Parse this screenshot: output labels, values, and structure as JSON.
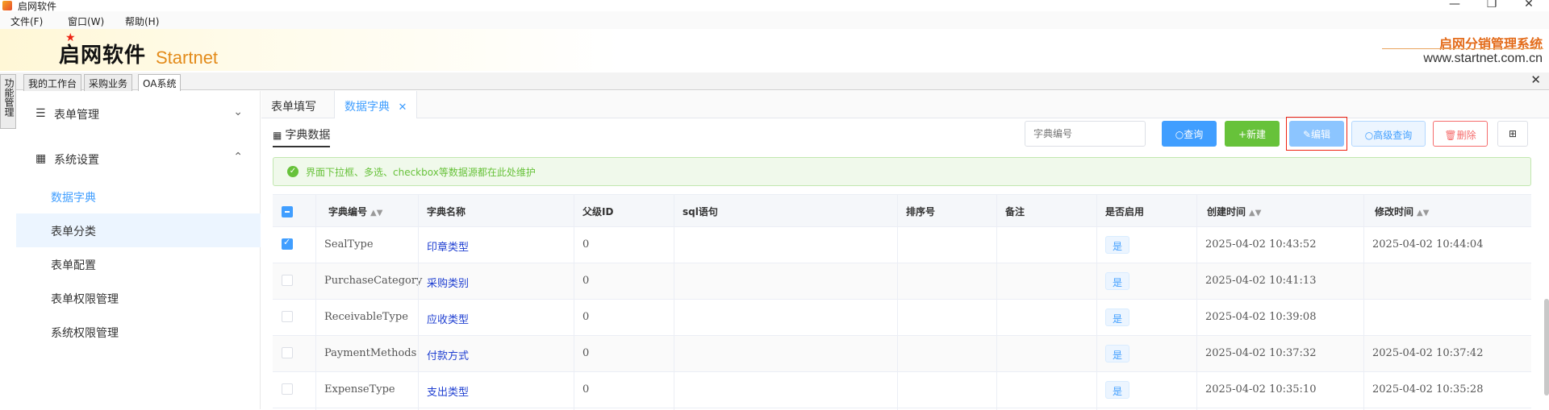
{
  "window": {
    "title": "启网软件",
    "controls": {
      "minimize": "—",
      "maximize": "❐",
      "close": "✕"
    }
  },
  "menu": [
    {
      "label": "文件(F)"
    },
    {
      "label": "窗口(W)"
    },
    {
      "label": "帮助(H)"
    }
  ],
  "banner": {
    "logo_cn": "启网软件",
    "logo_en": "Startnet",
    "system_name": "启网分销管理系统",
    "url": "www.startnet.com.cn"
  },
  "side_strip": {
    "label": "功能管理"
  },
  "top_tabs": [
    {
      "label": "我的工作台"
    },
    {
      "label": "采购业务"
    },
    {
      "label": "OA系统"
    }
  ],
  "sidebar": {
    "groups": [
      {
        "label": "表单管理",
        "icon": "sliders-icon",
        "chevron": "⌄"
      },
      {
        "label": "系统设置",
        "icon": "grid-icon",
        "chevron": "⌃"
      }
    ],
    "items": [
      {
        "label": "数据字典"
      },
      {
        "label": "表单分类"
      },
      {
        "label": "表单配置"
      },
      {
        "label": "表单权限管理"
      },
      {
        "label": "系统权限管理"
      }
    ]
  },
  "content_tabs": [
    {
      "label": "表单填写"
    },
    {
      "label": "数据字典",
      "close": "✕"
    }
  ],
  "panel": {
    "title": "字典数据",
    "search_placeholder": "字典编号",
    "buttons": {
      "query": "○查询",
      "new": "+新建",
      "edit": "✎编辑",
      "advanced": "○高级查询",
      "delete": "🗑删除",
      "columns": "⊞"
    },
    "alert": "界面下拉框、多选、checkbox等数据源都在此处维护"
  },
  "table": {
    "columns": [
      "字典编号",
      "字典名称",
      "父级ID",
      "sql语句",
      "排序号",
      "备注",
      "是否启用",
      "创建时间",
      "修改时间"
    ],
    "rows": [
      {
        "code": "SealType",
        "name": "印章类型",
        "parent": "0",
        "sql": "",
        "sort": "",
        "note": "",
        "enabled": "是",
        "created": "2025-04-02 10:43:52",
        "modified": "2025-04-02 10:44:04",
        "checked": true
      },
      {
        "code": "PurchaseCategory",
        "name": "采购类别",
        "parent": "0",
        "sql": "",
        "sort": "",
        "note": "",
        "enabled": "是",
        "created": "2025-04-02 10:41:13",
        "modified": "",
        "checked": false
      },
      {
        "code": "ReceivableType",
        "name": "应收类型",
        "parent": "0",
        "sql": "",
        "sort": "",
        "note": "",
        "enabled": "是",
        "created": "2025-04-02 10:39:08",
        "modified": "",
        "checked": false
      },
      {
        "code": "PaymentMethods",
        "name": "付款方式",
        "parent": "0",
        "sql": "",
        "sort": "",
        "note": "",
        "enabled": "是",
        "created": "2025-04-02 10:37:32",
        "modified": "2025-04-02 10:37:42",
        "checked": false
      },
      {
        "code": "ExpenseType",
        "name": "支出类型",
        "parent": "0",
        "sql": "",
        "sort": "",
        "note": "",
        "enabled": "是",
        "created": "2025-04-02 10:35:10",
        "modified": "2025-04-02 10:35:28",
        "checked": false
      }
    ]
  },
  "colors": {
    "primary": "#409eff",
    "success": "#67c23a",
    "danger": "#f56c6c",
    "brand_orange": "#e36b1a"
  }
}
